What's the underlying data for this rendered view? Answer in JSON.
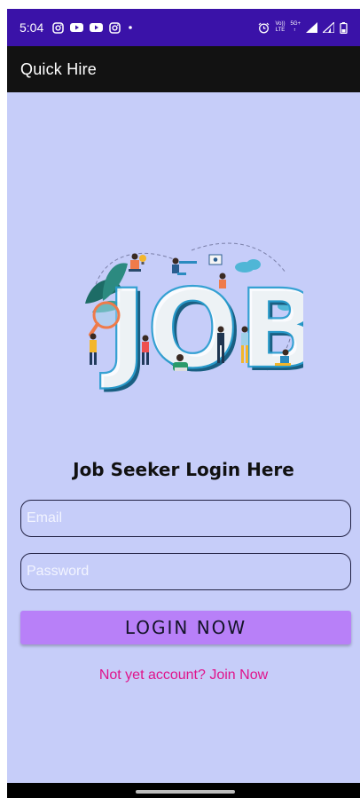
{
  "status_bar": {
    "time": "5:04",
    "left_icons": [
      "instagram-icon",
      "youtube-icon",
      "youtube-icon",
      "instagram-icon",
      "notification-dot-icon"
    ],
    "right_icons": [
      "alarm-icon",
      "volte-icon",
      "5g-icon",
      "signal-icon",
      "signal-icon",
      "battery-icon"
    ],
    "volte_line1": "Vo))",
    "volte_line2": "LTE",
    "network_type": "5G+",
    "background": "#3a12a8"
  },
  "app_bar": {
    "title": "Quick Hire",
    "background": "#121212"
  },
  "main": {
    "background": "#c6cdf9",
    "hero_icon": "job-illustration",
    "hero_text": "JOB",
    "heading": "Job Seeker Login Here",
    "email_placeholder": "Email",
    "email_value": "",
    "password_placeholder": "Password",
    "password_value": "",
    "login_label": "LOGIN NOW",
    "login_color": "#b880f8",
    "join_text": "Not yet account? Join Now",
    "join_color": "#e0148c"
  }
}
